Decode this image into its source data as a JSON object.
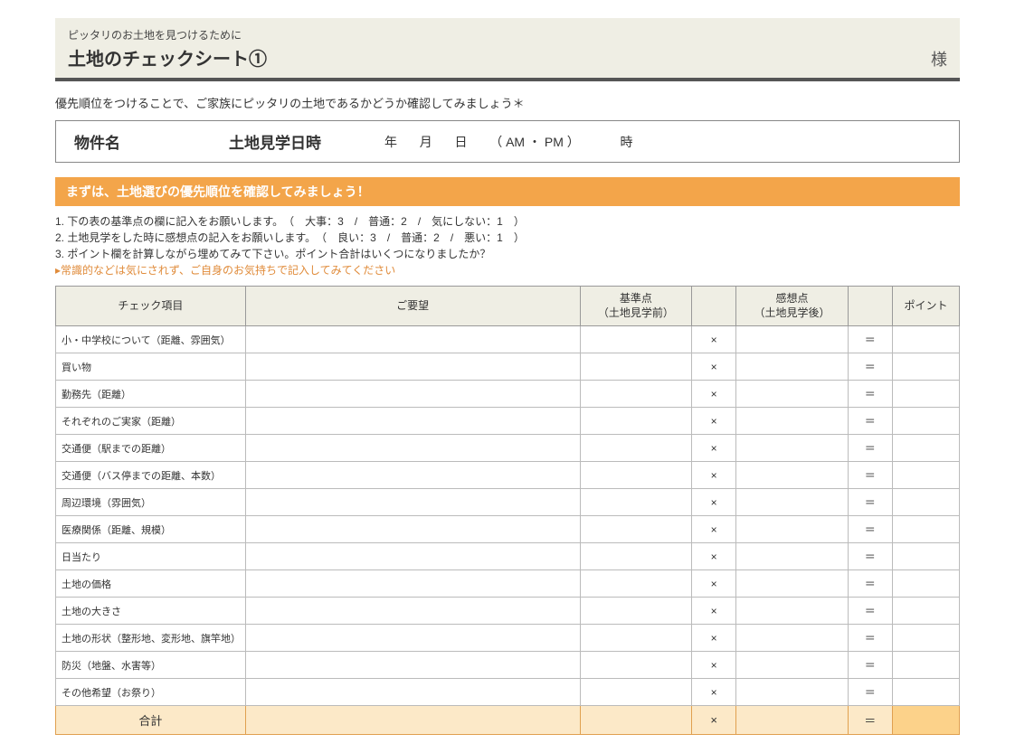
{
  "header": {
    "subtitle": "ピッタリのお土地を見つけるために",
    "title": "土地のチェックシート①",
    "sama": "様"
  },
  "intro": "優先順位をつけることで、ご家族にピッタリの土地であるかどうか確認してみましょう＊",
  "infoBar": {
    "propertyLabel": "物件名",
    "dateLabel": "土地見学日時",
    "year": "年",
    "month": "月",
    "day": "日",
    "ampm": "（ AM ・ PM ）",
    "hour": "時"
  },
  "orangeBar": "まずは、土地選びの優先順位を確認してみましょう！",
  "instructions": {
    "line1": "1. 下の表の基準点の欄に記入をお願いします。　（　大事：3　/　普通：2　/　気にしない：1　）",
    "line2": "2. 土地見学をした時に感想点の記入をお願いします。　（　良い：3　/　普通：2　/　悪い：1　）",
    "line3": "3. ポイント欄を計算しながら埋めてみて下さい。ポイント合計はいくつになりましたか？",
    "note": "▸常識的などは気にされず、ご自身のお気持ちで記入してみてください"
  },
  "tableHeaders": {
    "check": "チェック項目",
    "request": "ご要望",
    "base": "基準点\n（土地見学前）",
    "x": "",
    "impression": "感想点\n（土地見学後）",
    "eq": "",
    "point": "ポイント"
  },
  "symbols": {
    "mult": "×",
    "eq": "＝"
  },
  "items": [
    "小・中学校について（距離、雰囲気）",
    "買い物",
    "勤務先（距離）",
    "それぞれのご実家（距離）",
    "交通便（駅までの距離）",
    "交通便（バス停までの距離、本数）",
    "周辺環境（雰囲気）",
    "医療関係（距離、規模）",
    "日当たり",
    "土地の価格",
    "土地の大きさ",
    "土地の形状（整形地、変形地、旗竿地）",
    "防災（地盤、水害等）",
    "その他希望（お祭り）"
  ],
  "totalLabel": "合計"
}
